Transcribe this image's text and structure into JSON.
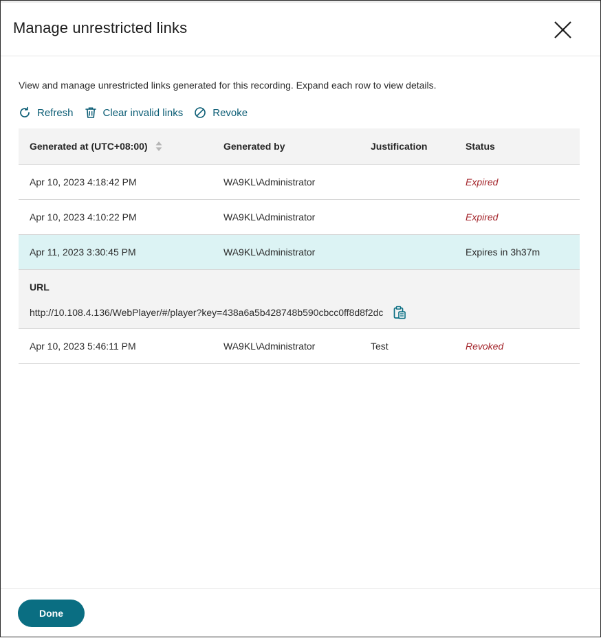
{
  "dialog": {
    "title": "Manage unrestricted links",
    "description": "View and manage unrestricted links generated for this recording. Expand each row to view details."
  },
  "toolbar": {
    "refresh_label": "Refresh",
    "clear_label": "Clear invalid links",
    "revoke_label": "Revoke"
  },
  "table": {
    "columns": [
      "Generated at (UTC+08:00)",
      "Generated by",
      "Justification",
      "Status"
    ],
    "rows": [
      {
        "generated_at": "Apr 10, 2023 4:18:42 PM",
        "generated_by": "WA9KL\\Administrator",
        "justification": "",
        "status": "Expired"
      },
      {
        "generated_at": "Apr 10, 2023 4:10:22 PM",
        "generated_by": "WA9KL\\Administrator",
        "justification": "",
        "status": "Expired"
      },
      {
        "generated_at": "Apr 11, 2023 3:30:45 PM",
        "generated_by": "WA9KL\\Administrator",
        "justification": "",
        "status": "Expires in 3h37m"
      },
      {
        "generated_at": "Apr 10, 2023 5:46:11 PM",
        "generated_by": "WA9KL\\Administrator",
        "justification": "Test",
        "status": "Revoked"
      }
    ],
    "detail": {
      "label": "URL",
      "url": "http://10.108.4.136/WebPlayer/#/player?key=438a6a5b428748b590cbcc0ff8d8f2dc"
    }
  },
  "footer": {
    "done_label": "Done"
  },
  "colors": {
    "accent": "#0a6e82",
    "link": "#0a5c74",
    "status_red": "#a4262c",
    "selected_row": "#dcf3f4"
  },
  "icons": {
    "close": "close-icon",
    "refresh": "refresh-icon",
    "clear": "trash-icon",
    "revoke": "block-icon",
    "sort": "sort-icon",
    "copy": "clipboard-icon"
  }
}
